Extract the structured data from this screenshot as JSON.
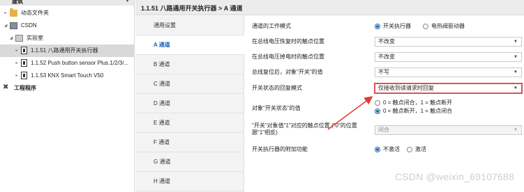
{
  "tree": {
    "top_label": "建筑",
    "items": [
      {
        "label": "动态文件夹"
      },
      {
        "label": "CSDN"
      },
      {
        "label": "实验室"
      },
      {
        "label": "1.1.51 八路通用开关执行器"
      },
      {
        "label": "1.1.52 Push button sensor Plus.1/2/3/..."
      },
      {
        "label": "1.1.53 KNX Smart Touch V50"
      },
      {
        "label": "工程程序"
      }
    ]
  },
  "header": {
    "breadcrumb": "1.1.51 八路通用开关执行器 > A 通道"
  },
  "tabs": [
    {
      "label": "通用设置"
    },
    {
      "label": "A 通道"
    },
    {
      "label": "B 通道"
    },
    {
      "label": "C 通道"
    },
    {
      "label": "D 通道"
    },
    {
      "label": "E 通道"
    },
    {
      "label": "F 通道"
    },
    {
      "label": "G 通道"
    },
    {
      "label": "H 通道"
    }
  ],
  "params": {
    "mode": {
      "label": "通道的工作模式",
      "opt1": "开关执行器",
      "opt2": "电热阀驱动器"
    },
    "bus_recover": {
      "label": "在总线电压恢复时的触点位置",
      "value": "不改变"
    },
    "bus_fail": {
      "label": "在总线电压掉电时的触点位置",
      "value": "不改变"
    },
    "after_reset": {
      "label": "总线复位后，对象\"开关\"的值",
      "value": "不写"
    },
    "reply_mode": {
      "label": "开关状态的回复模式",
      "value": "仅接收到读请求时回复"
    },
    "status_value": {
      "label": "对象\"开关状态\"的值",
      "opt1": "0 = 触点闭合，1 = 触点断开",
      "opt2": "0 = 触点断开，1 = 触点闭合"
    },
    "contact_pos": {
      "label": "\"开关\"对象值\"1\"对应的触点位置 (\"0\"的位置跟\"1\"相反)",
      "value": "闭合"
    },
    "extra_func": {
      "label": "开关执行器的附加功能",
      "opt1": "不激活",
      "opt2": "激活"
    }
  },
  "watermark": "CSDN @weixin_69107688",
  "colors": {
    "accent": "#1a5fb4",
    "arrow": "#e03a2f",
    "highlight_border": "#d9534f"
  }
}
